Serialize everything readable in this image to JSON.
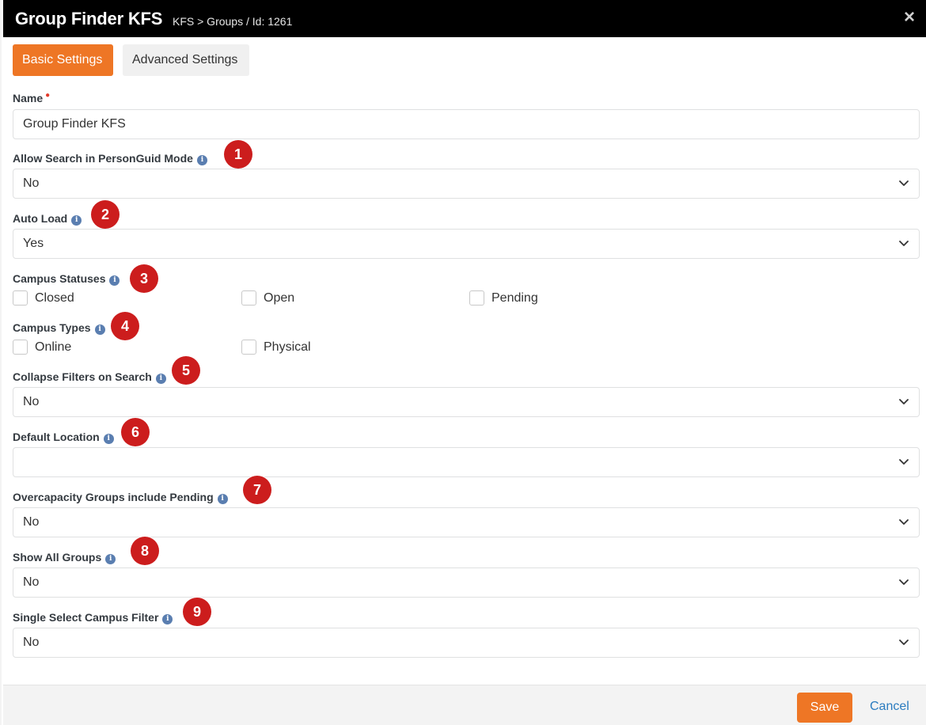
{
  "header": {
    "title": "Group Finder KFS",
    "breadcrumb": "KFS > Groups / Id: 1261",
    "close_icon": "×"
  },
  "tabs": [
    {
      "label": "Basic Settings",
      "active": true
    },
    {
      "label": "Advanced Settings",
      "active": false
    }
  ],
  "fields": {
    "name": {
      "label": "Name",
      "value": "Group Finder KFS",
      "required": true
    },
    "allow_search": {
      "label": "Allow Search in PersonGuid Mode",
      "value": "No",
      "badge": "1"
    },
    "auto_load": {
      "label": "Auto Load",
      "value": "Yes",
      "badge": "2"
    },
    "campus_statuses": {
      "label": "Campus Statuses",
      "badge": "3",
      "options": [
        "Closed",
        "Open",
        "Pending"
      ]
    },
    "campus_types": {
      "label": "Campus Types",
      "badge": "4",
      "options": [
        "Online",
        "Physical"
      ]
    },
    "collapse_filters": {
      "label": "Collapse Filters on Search",
      "value": "No",
      "badge": "5"
    },
    "default_location": {
      "label": "Default Location",
      "value": "",
      "badge": "6"
    },
    "overcapacity": {
      "label": "Overcapacity Groups include Pending",
      "value": "No",
      "badge": "7"
    },
    "show_all_groups": {
      "label": "Show All Groups",
      "value": "No",
      "badge": "8"
    },
    "single_select_campus": {
      "label": "Single Select Campus Filter",
      "value": "No",
      "badge": "9"
    }
  },
  "info_icon": "i",
  "footer": {
    "save_label": "Save",
    "cancel_label": "Cancel"
  },
  "colors": {
    "accent": "#ee7625",
    "header_bg": "#000000",
    "badge": "#cc1d1d",
    "info": "#5a7eb0",
    "link": "#2a7bbf"
  }
}
